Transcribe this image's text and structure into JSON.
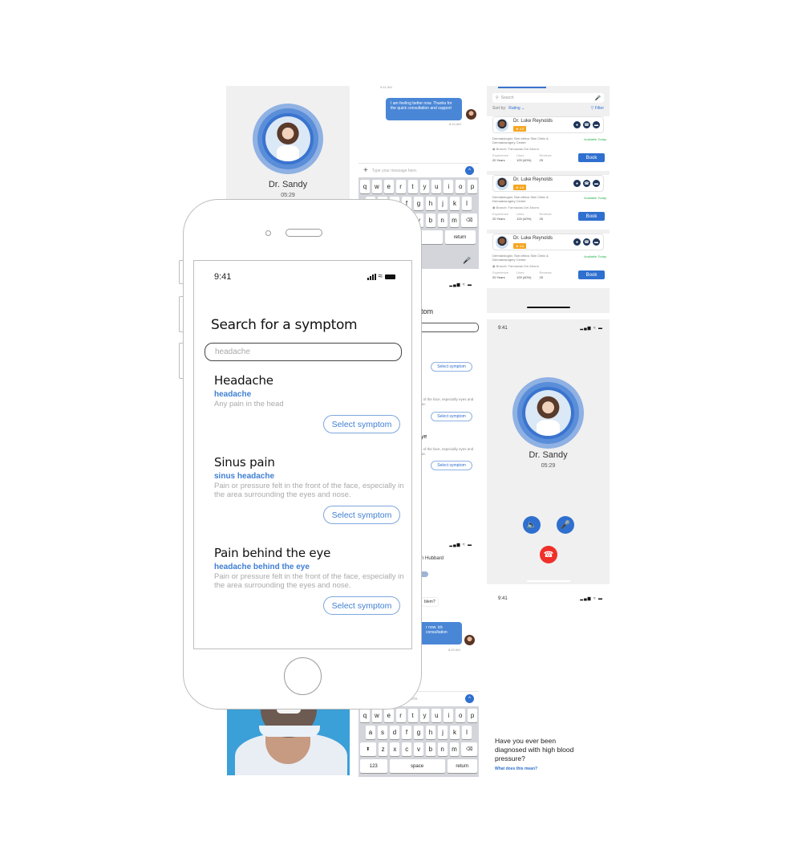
{
  "call_top": {
    "doctor_name": "Dr. Sandy",
    "duration": "05:29"
  },
  "chat_top": {
    "time_header": "9:41 AM",
    "message": "I am feeling better now. Thanks for the quick consultation and support",
    "message_time": "8:43 AM",
    "input_placeholder": "Type your message here.",
    "keyboard_row1": [
      "q",
      "w",
      "e",
      "r",
      "t",
      "y",
      "u",
      "i",
      "o",
      "p"
    ],
    "keyboard_row2": [
      "a",
      "s",
      "d",
      "f",
      "g",
      "h",
      "j",
      "k",
      "l"
    ],
    "keyboard_row3": [
      "z",
      "x",
      "c",
      "v",
      "b",
      "n",
      "m"
    ],
    "space_label": "space",
    "return_label": "return",
    "numbers_label": "123"
  },
  "doctor_list": {
    "search_placeholder": "Search",
    "sort_label": "Sort by:",
    "sort_value": "Rating",
    "filter_label": "Filter",
    "doctors": [
      {
        "name": "Dr. Luke Reynolds",
        "rating": "4.5",
        "specialty": "Dermatologist, Skin ethics Skin Clinic & Dermatosurgery Center",
        "availability": "Available Today",
        "branch": "Branch: Farmacias Del Ahorro",
        "experience_label": "Experience",
        "experience": "20 Years",
        "likes_label": "Likes",
        "likes": "125 (40%)",
        "reviews_label": "Reviews",
        "reviews": "25",
        "book_label": "Book"
      },
      {
        "name": "Dr. Luke Reynolds",
        "rating": "4.6",
        "specialty": "Dermatologist, Skin ethics Skin Clinic & Dermatosurgery Center",
        "availability": "Available Today",
        "branch": "Branch: Farmacias Del Ahorro",
        "experience_label": "Experience",
        "experience": "20 Years",
        "likes_label": "Likes",
        "likes": "125 (40%)",
        "reviews_label": "Reviews",
        "reviews": "25",
        "book_label": "Book"
      },
      {
        "name": "Dr. Luke Reynolds",
        "rating": "4.6",
        "specialty": "Dermatologist, Skin ethics Skin Clinic & Dermatosurgery Center",
        "availability": "Available Today",
        "branch": "Branch: Farmacias Del Ahorro",
        "experience_label": "Experience",
        "experience": "20 Years",
        "likes_label": "Likes",
        "likes": "125 (40%)",
        "reviews_label": "Reviews",
        "reviews": "25",
        "book_label": "Book"
      }
    ]
  },
  "call_full": {
    "status_time": "9:41",
    "doctor_name": "Dr. Sandy",
    "duration": "05:29"
  },
  "question": {
    "status_time": "9:41",
    "text": "Have you ever been diagnosed with high blood pressure?",
    "link": "What does this mean?"
  },
  "symptom_back": {
    "title_fragment": "tom",
    "select_label": "Select symptom",
    "desc_fragment_1": "ont of the face, especially eyes and nose.",
    "desc_fragment_2": "ont of the face, especially eyes and nose.",
    "eye_fragment": "ye"
  },
  "chat_bottom": {
    "contact_fragment": "n Hubbard",
    "question_fragment": "blem?",
    "message_fragment": "r now. ick consultation",
    "message_time": "8:43 AM",
    "input_placeholder_fragment": "ere."
  },
  "phone": {
    "status_time": "9:41",
    "page_title": "Search for a symptom",
    "search_value": "headache",
    "symptoms": [
      {
        "title": "Headache",
        "term": "headache",
        "description": "Any pain in the head",
        "button": "Select symptom"
      },
      {
        "title": "Sinus pain",
        "term": "sinus headache",
        "description": "Pain or pressure felt in the front of the face, especially in the area surrounding the eyes and nose.",
        "button": "Select symptom"
      },
      {
        "title": "Pain behind the eye",
        "term": "headache behind the eye",
        "description": "Pain or pressure felt in the front of the face, especially in the area surrounding the eyes and nose.",
        "button": "Select symptom"
      }
    ]
  },
  "colors": {
    "primary": "#2f6fcf",
    "accent_blue": "#3f7fd3",
    "rating_orange": "#f5a623",
    "available_green": "#2bb24c",
    "end_call_red": "#f0302a"
  }
}
